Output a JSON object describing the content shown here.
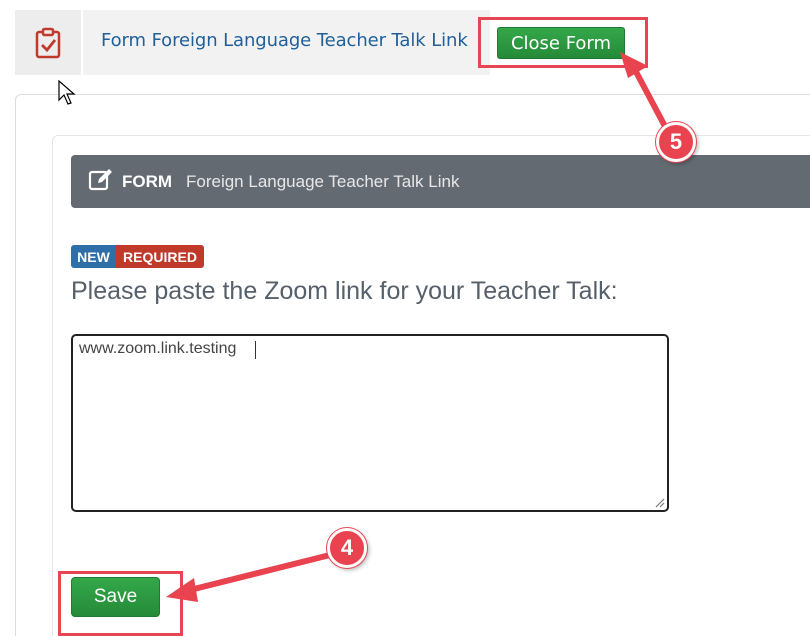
{
  "tabbar": {
    "form_title": "Form Foreign Language Teacher Talk Link",
    "close_label": "Close Form",
    "icon": "clipboard-check-icon"
  },
  "form_header": {
    "label": "FORM",
    "name": "Foreign Language Teacher Talk Link",
    "icon": "edit-icon"
  },
  "badges": {
    "new": "NEW",
    "required": "REQUIRED"
  },
  "question": {
    "text": "Please paste the Zoom link for your Teacher Talk:",
    "answer": "www.zoom.link.testing"
  },
  "actions": {
    "save_label": "Save"
  },
  "annotations": {
    "step_close": "5",
    "step_save": "4"
  },
  "colors": {
    "accent_green": "#2e9b41",
    "link_blue": "#1f5f9a",
    "header_gray": "#636a72",
    "badge_blue": "#2f6fa8",
    "badge_red": "#c0392b",
    "annotation_red": "#e8434e"
  }
}
